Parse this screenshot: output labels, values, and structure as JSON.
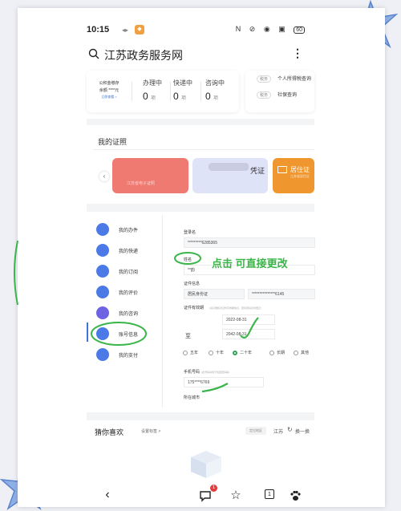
{
  "status_bar": {
    "time": "10:15",
    "battery": "60"
  },
  "header": {
    "title": "江苏政务服务网"
  },
  "account_card": {
    "line1": "公积金缴存",
    "line2": "余额 ****元",
    "line3": "立即查看 >",
    "stats": [
      {
        "label": "办理中",
        "value": "0",
        "unit": "项"
      },
      {
        "label": "快递中",
        "value": "0",
        "unit": "项"
      },
      {
        "label": "咨询中",
        "value": "0",
        "unit": "项"
      }
    ]
  },
  "quick_queries": [
    {
      "tag": "税务",
      "label": "个人所得税查询"
    },
    {
      "tag": "税务",
      "label": "社保查询"
    }
  ],
  "certificates": {
    "section_title": "我的证照",
    "items": [
      {
        "title": "",
        "subtitle": "江苏省电子证照"
      },
      {
        "title": "凭证",
        "subtitle": ""
      },
      {
        "title": "居住证",
        "subtitle": "江苏省居住证"
      }
    ]
  },
  "side_menu": {
    "items": [
      {
        "label": "我的办件",
        "color": "#4b7ae6"
      },
      {
        "label": "我的快递",
        "color": "#4b7ae6"
      },
      {
        "label": "我的订阅",
        "color": "#4b7ae6"
      },
      {
        "label": "我的评价",
        "color": "#4b7ae6"
      },
      {
        "label": "我的咨询",
        "color": "#6d63e2"
      },
      {
        "label": "账号信息",
        "color": "#4b7ae6"
      },
      {
        "label": "我的支付",
        "color": "#4b7ae6"
      }
    ],
    "active_index": 5
  },
  "account_form": {
    "login_label": "登录名",
    "login_value": "*********6285365",
    "name_label": "姓名",
    "name_value": "**韵",
    "id_label": "证件信息",
    "id_type": "居民身份证",
    "id_number": "***************6145",
    "validity_label": "证件有效期",
    "validity_note": "(请仔细核对证件有效期信息，若有误请及时更正)",
    "start_date": "2022-08-31",
    "to_label": "至",
    "end_date": "2042-08-31",
    "validity_options": [
      "五年",
      "十年",
      "二十年",
      "长期",
      "其他"
    ],
    "validity_selected": 2,
    "phone_label": "手机号码",
    "phone_note": "(此号码将用于找回密码等)",
    "phone_value": "175****6769",
    "city_label": "所在城市"
  },
  "annotation": {
    "text": "点击 可直接更改",
    "color": "#3bb54a"
  },
  "recommend": {
    "title": "猜你喜欢",
    "settings_label": "设置标签 >",
    "region": "定位地区",
    "city": "江苏",
    "change_label": "换一换"
  },
  "bottom_nav": {
    "back": "‹",
    "message_badge": "1",
    "tab_count": "1"
  }
}
